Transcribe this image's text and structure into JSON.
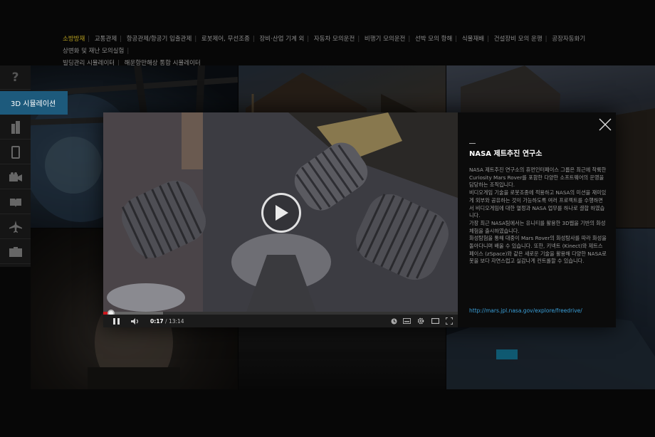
{
  "topnav": {
    "items": [
      {
        "label": "소방방재",
        "active": true
      },
      {
        "label": "교통관제"
      },
      {
        "label": "항공관제/항공기 입출관제"
      },
      {
        "label": "로봇제어, 무선조종"
      },
      {
        "label": "장비·산업 기계 외"
      },
      {
        "label": "자동차 모의운전"
      },
      {
        "label": "비행기 모의운전"
      },
      {
        "label": "선박 모의 항해"
      },
      {
        "label": "식물재배"
      },
      {
        "label": "건설장비 모의 운행"
      },
      {
        "label": "공장자동화기상변화 및 재난 모의실험"
      },
      {
        "label": "빌딩관리 시뮬레이터"
      },
      {
        "label": "해운항만해상 통합 시뮬레이터"
      }
    ]
  },
  "sidebar": {
    "help_glyph": "?",
    "active_label": "3D 시뮬레이션",
    "icons": [
      "building-icon",
      "tablet-icon",
      "camera-icon",
      "book-icon",
      "airplane-icon",
      "box-icon"
    ]
  },
  "video": {
    "current_time": "0:17",
    "duration": "13:14",
    "progress": 0.0214,
    "buffered": 0.169
  },
  "panel": {
    "title": "NASA 제트추진 연구소",
    "description": "NASA 제트추진 연구소의 휴먼인터페이스 그룹은 최근에 착륙한 Curiosity Mars Rover를 포함한 다양한 소프트웨어의 운영을 담당하는 조직입니다.\n 비디오게임 기술을 로봇조종에 적용하고 NASA의 미션을 재미있게 외부와 공유하는 것이 가능하도록 여러 프로젝트를 수행하면서 비디오게임에 대한 열정과 NASA 업무를 하나로 결합 하였습니다.\n가장 최근 NASA팀에서는 유니티를 활용한 3D웹을 기반의 화성 체험을 출시하였습니다.\n 화성탐험을 통해 대중이 Mars Rover의 화성탐사를 따라 화성을 돌아다니며 배울 수 있습니다. 또한, 키넥트 (Kinect)와 제트스페이스 (zSpace)와 같은 새로운 기술을 활용해 다양한 NASA로봇을 보다 자연스럽고 실감나게 컨트롤할 수 있습니다.",
    "link": "http://mars.jpl.nasa.gov/explore/freedrive/"
  },
  "colors": {
    "accent_active_nav": "#b8a020",
    "sidebar_active": "#1d5a7c",
    "progress_played": "#cc181e",
    "link": "#3a9fd8"
  }
}
